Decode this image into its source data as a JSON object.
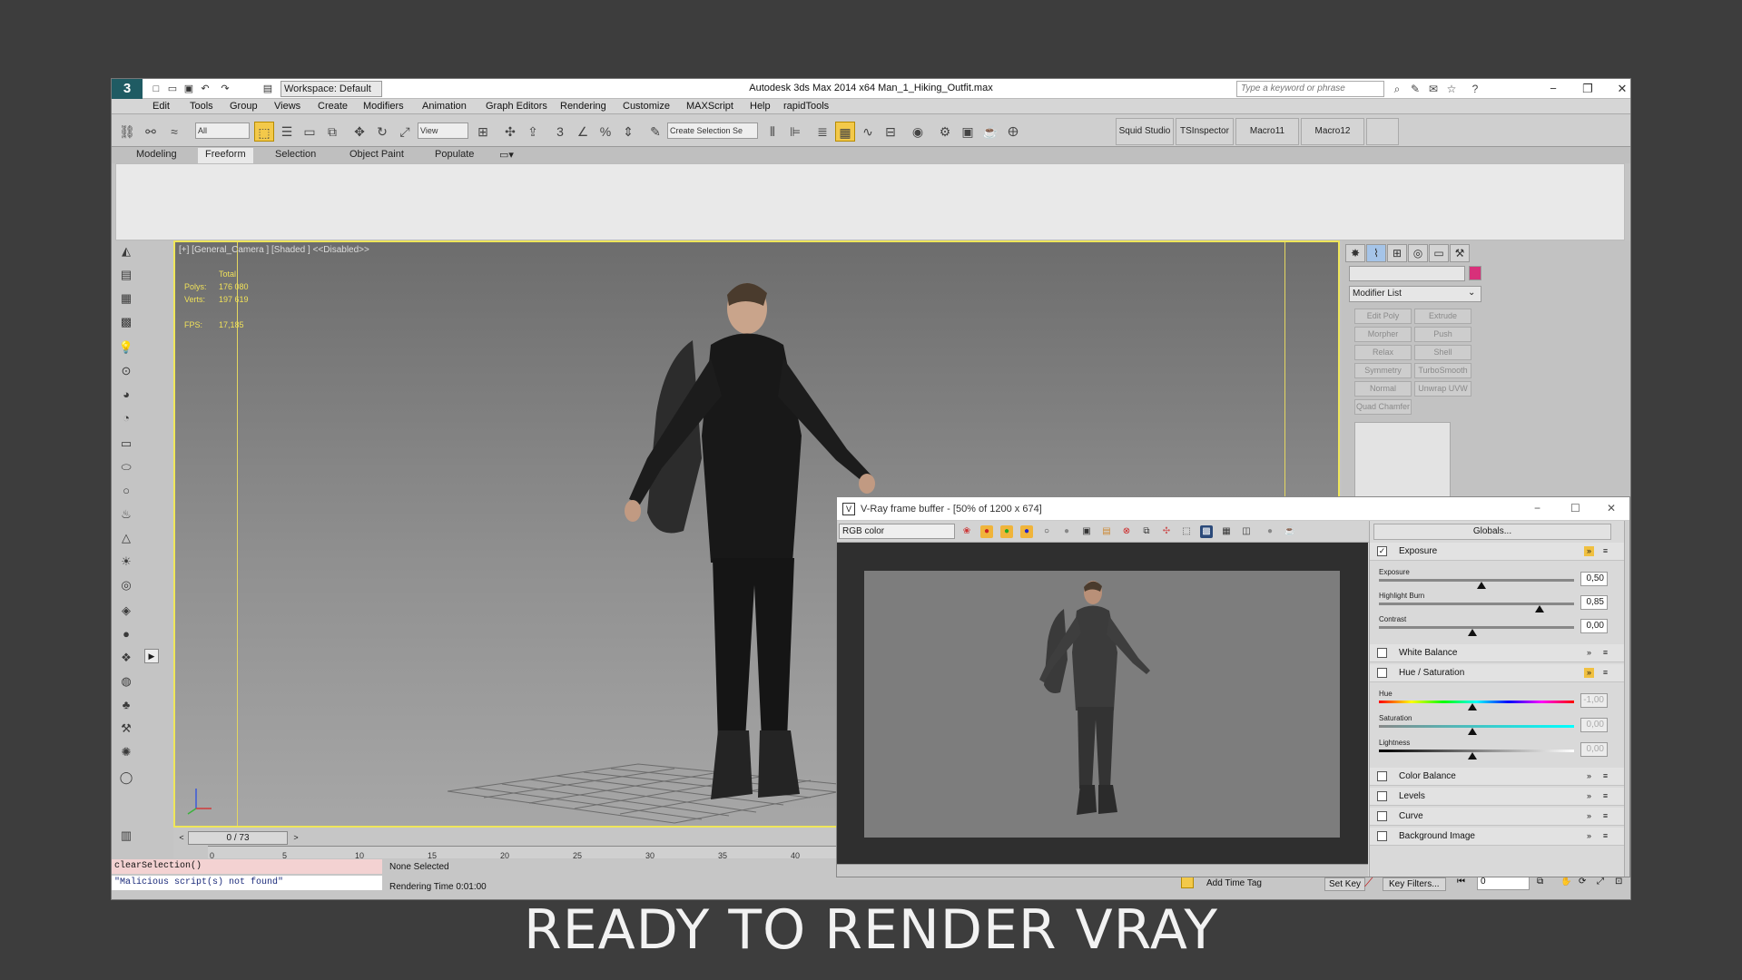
{
  "titlebar": {
    "workspace": "Workspace: Default",
    "title": "Autodesk 3ds Max  2014 x64    Man_1_Hiking_Outfit.max",
    "search_placeholder": "Type a keyword or phrase"
  },
  "menu": [
    "Edit",
    "Tools",
    "Group",
    "Views",
    "Create",
    "Modifiers",
    "Animation",
    "Graph Editors",
    "Rendering",
    "Customize",
    "MAXScript",
    "Help",
    "rapidTools"
  ],
  "toolbar": {
    "filter": "All",
    "ref_coord": "View",
    "selection_set": "Create Selection Se",
    "custom_buttons": [
      "Squid Studio v",
      "TSInspector",
      "Macro11",
      "Macro12"
    ]
  },
  "ribbon_tabs": [
    "Modeling",
    "Freeform",
    "Selection",
    "Object Paint",
    "Populate"
  ],
  "viewport": {
    "label": "[+] [General_Camera ] [Shaded ]  <<Disabled>>",
    "stats_header": "Total",
    "polys_label": "Polys:",
    "polys": "176 080",
    "verts_label": "Verts:",
    "verts": "197 619",
    "fps_label": "FPS:",
    "fps": "17,185"
  },
  "command_panel": {
    "modifier_list": "Modifier List",
    "buttons": [
      "Edit Poly",
      "Extrude",
      "Morpher",
      "Push",
      "Relax",
      "Shell",
      "Symmetry",
      "TurboSmooth",
      "Normal",
      "Unwrap UVW",
      "Quad Chamfer"
    ],
    "color_swatch": "#d8307a"
  },
  "timeline": {
    "frame": "0 / 73",
    "ticks": [
      "0",
      "5",
      "10",
      "15",
      "20",
      "25",
      "30",
      "35",
      "40"
    ]
  },
  "status": {
    "listener_input": "clearSelection()",
    "listener_output": "\"Malicious script(s) not found\"",
    "selection": "None Selected",
    "render_time": "Rendering Time  0:01:00",
    "add_time_tag": "Add Time Tag",
    "set_key": "Set Key",
    "key_filters": "Key Filters...",
    "frame_field": "0"
  },
  "vfb": {
    "title": "V-Ray frame buffer - [50% of 1200 x 674]",
    "channel": "RGB color",
    "globals": "Globals...",
    "exposure": {
      "label": "Exposure",
      "p1_label": "Exposure",
      "p1": "0,50",
      "p2_label": "Highlight Burn",
      "p2": "0,85",
      "p3_label": "Contrast",
      "p3": "0,00"
    },
    "white_balance": "White Balance",
    "hue_sat": {
      "label": "Hue / Saturation",
      "hue_label": "Hue",
      "hue": "-1,00",
      "sat_label": "Saturation",
      "sat": "0,00",
      "light_label": "Lightness",
      "light": "0,00"
    },
    "color_balance": "Color Balance",
    "levels": "Levels",
    "curve": "Curve",
    "background_image": "Background Image"
  },
  "caption": "READY TO RENDER VRAY"
}
